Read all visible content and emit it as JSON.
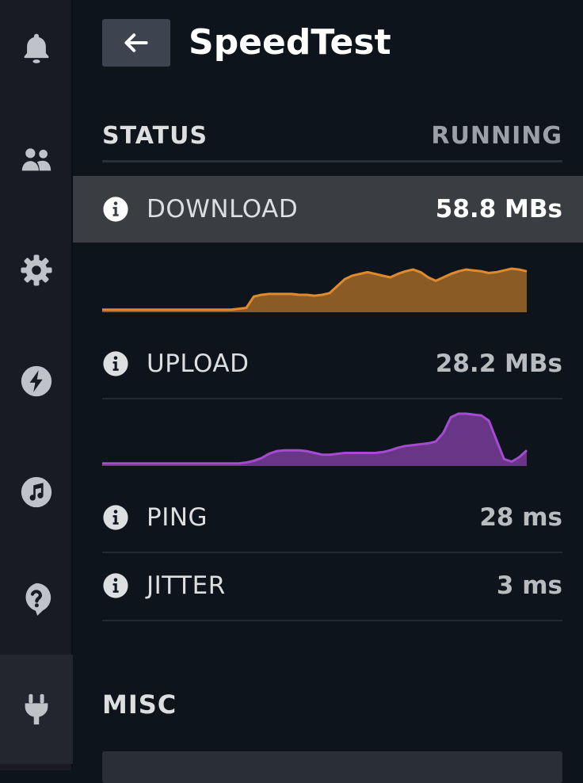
{
  "sidebar": {
    "items": [
      {
        "name": "notifications",
        "icon": "bell-icon"
      },
      {
        "name": "friends",
        "icon": "people-icon"
      },
      {
        "name": "settings",
        "icon": "gear-icon"
      },
      {
        "name": "performance",
        "icon": "lightning-icon"
      },
      {
        "name": "music",
        "icon": "music-note-icon"
      },
      {
        "name": "help",
        "icon": "question-icon"
      },
      {
        "name": "plugins",
        "icon": "plug-icon",
        "active": true
      }
    ]
  },
  "header": {
    "back_icon": "arrow-left-icon",
    "title": "SpeedTest"
  },
  "status": {
    "label": "STATUS",
    "value": "RUNNING"
  },
  "metrics": {
    "download": {
      "label": "DOWNLOAD",
      "value": "58.8 MBs"
    },
    "upload": {
      "label": "UPLOAD",
      "value": "28.2 MBs"
    },
    "ping": {
      "label": "PING",
      "value": "28 ms"
    },
    "jitter": {
      "label": "JITTER",
      "value": "3 ms"
    }
  },
  "graphs": {
    "download": {
      "color": "#e08a2e",
      "values": [
        3,
        3,
        3,
        3,
        3,
        3,
        3,
        3,
        3,
        3,
        3,
        3,
        3,
        3,
        3,
        3,
        3,
        3,
        4,
        5,
        18,
        20,
        21,
        21,
        21,
        21,
        20,
        20,
        19,
        20,
        22,
        30,
        38,
        42,
        44,
        46,
        44,
        42,
        40,
        44,
        47,
        49,
        46,
        40,
        36,
        40,
        44,
        47,
        49,
        48,
        47,
        45,
        46,
        48,
        50,
        49,
        47
      ]
    },
    "upload": {
      "color": "#a54bd0",
      "values": [
        3,
        3,
        3,
        3,
        3,
        3,
        3,
        3,
        3,
        3,
        3,
        3,
        3,
        3,
        3,
        3,
        3,
        3,
        3,
        4,
        6,
        9,
        14,
        17,
        18,
        18,
        18,
        17,
        15,
        13,
        13,
        14,
        15,
        15,
        15,
        15,
        15,
        16,
        18,
        21,
        23,
        24,
        25,
        26,
        28,
        38,
        56,
        60,
        60,
        59,
        58,
        52,
        30,
        8,
        5,
        10,
        18
      ]
    },
    "ymax": 60
  },
  "misc": {
    "title": "MISC"
  }
}
